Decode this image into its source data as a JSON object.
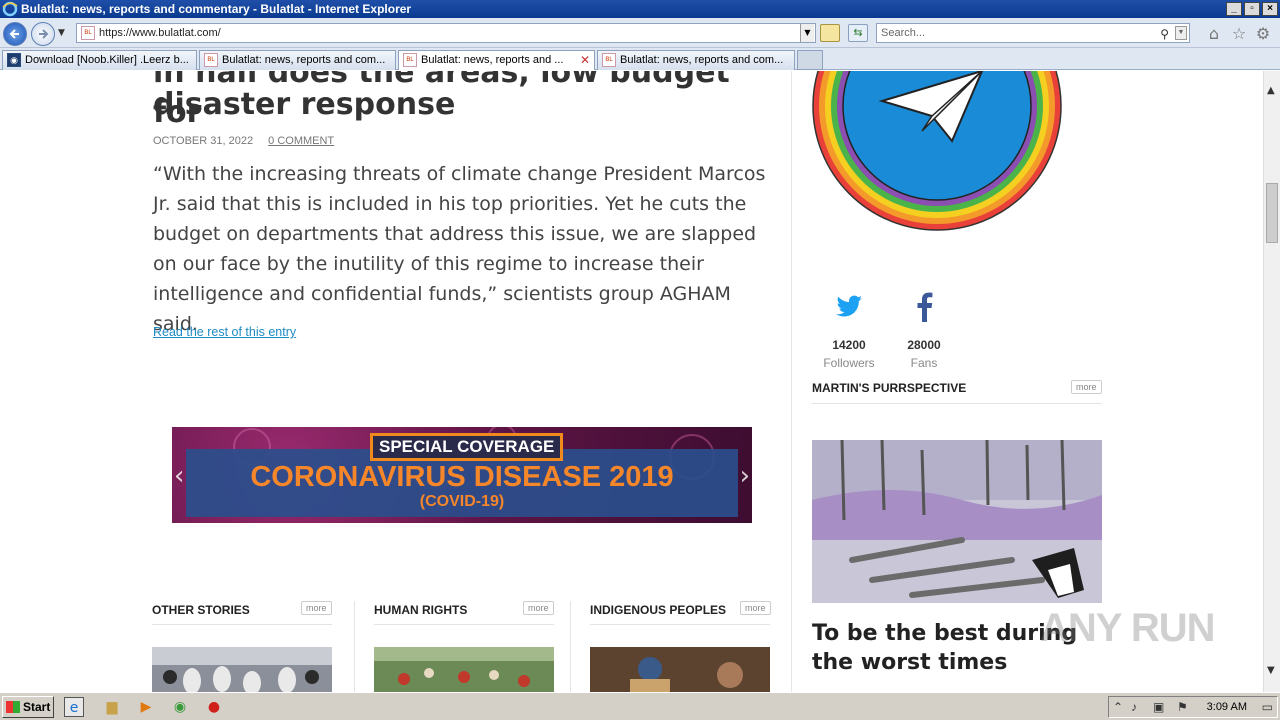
{
  "window": {
    "title": "Bulatlat: news, reports and commentary - Bulatlat - Internet Explorer"
  },
  "address": {
    "url": "https://www.bulatlat.com/",
    "search_placeholder": "Search..."
  },
  "tabs": [
    {
      "label": "Download [Noob.Killer] .Leerz b...",
      "active": false
    },
    {
      "label": "Bulatlat: news, reports and com...",
      "active": false
    },
    {
      "label": "Bulatlat: news, reports and ...",
      "active": true
    },
    {
      "label": "Bulatlat: news, reports and com...",
      "active": false
    }
  ],
  "article": {
    "title_cut": "in hall does the areas, low budget for",
    "title": "disaster response",
    "date": "OCTOBER 31, 2022",
    "comments": "0 COMMENT",
    "excerpt": "“With the increasing threats of climate change President Marcos Jr. said that this is included in his top priorities. Yet he cuts the budget on departments that address this issue, we are slapped on our face by the inutility of this regime to increase their intelligence and confidential funds,” scientists group AGHAM said.",
    "read_more": "Read the rest of this entry"
  },
  "banner": {
    "special": "SPECIAL COVERAGE",
    "headline": "CORONAVIRUS DISEASE 2019",
    "sub": "(COVID-19)"
  },
  "sections": [
    {
      "title": "OTHER STORIES",
      "more": "more"
    },
    {
      "title": "HUMAN RIGHTS",
      "more": "more"
    },
    {
      "title": "INDIGENOUS PEOPLES",
      "more": "more"
    }
  ],
  "sidebar": {
    "twitter": {
      "count": "14200",
      "label": "Followers"
    },
    "facebook": {
      "count": "28000",
      "label": "Fans"
    },
    "purr": {
      "title": "MARTIN'S PURRSPECTIVE",
      "more": "more"
    },
    "cartoon_title": "To be the best during the worst times"
  },
  "watermark": "ANY RUN",
  "taskbar": {
    "start": "Start",
    "clock": "3:09 AM"
  },
  "colors": {
    "link": "#1f8bc4",
    "banner_orange": "#f5862a",
    "twitter": "#1da1f2",
    "facebook": "#3b5998"
  }
}
